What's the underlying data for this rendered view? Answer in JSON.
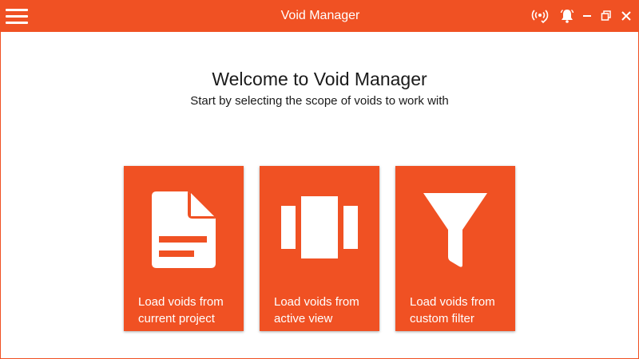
{
  "window": {
    "title": "Void Manager",
    "accent_color": "#f05123",
    "titlebar_icons": [
      "broadcast-icon",
      "bell-icon",
      "minimize-icon",
      "restore-icon",
      "close-icon"
    ]
  },
  "main": {
    "heading": "Welcome to Void Manager",
    "subheading": "Start by selecting the scope of voids to work with"
  },
  "tiles": [
    {
      "icon": "document-icon",
      "line1": "Load voids from",
      "line2": "current project"
    },
    {
      "icon": "view-carousel-icon",
      "line1": "Load voids from",
      "line2": "active view"
    },
    {
      "icon": "filter-icon",
      "line1": "Load voids from",
      "line2": "custom filter"
    }
  ]
}
